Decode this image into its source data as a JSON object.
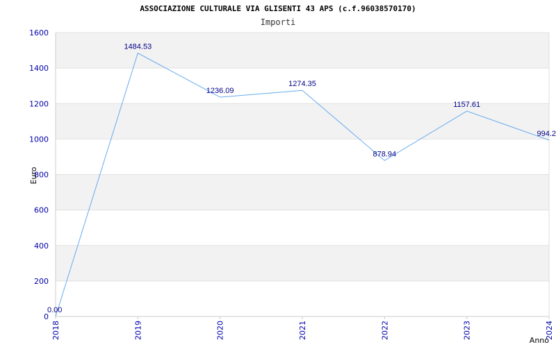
{
  "chart_data": {
    "type": "line",
    "title": "ASSOCIAZIONE CULTURALE VIA GLISENTI 43 APS (c.f.96038570170)",
    "subtitle": "Importi",
    "xlabel": "Anno",
    "ylabel": "Euro",
    "categories": [
      "2018",
      "2019",
      "2020",
      "2021",
      "2022",
      "2023",
      "2024"
    ],
    "series": [
      {
        "values": [
          0.0,
          1484.53,
          1236.09,
          1274.35,
          878.94,
          1157.61,
          994.2
        ],
        "labels": [
          "0.00",
          "1484.53",
          "1236.09",
          "1274.35",
          "878.94",
          "1157.61",
          "994.2"
        ]
      }
    ],
    "ylim": [
      0,
      1600
    ],
    "yticks": [
      "0",
      "200",
      "400",
      "600",
      "800",
      "1000",
      "1200",
      "1400",
      "1600"
    ],
    "grid": "horizontal alternating bands",
    "colors": {
      "line": "#66aaee",
      "band": "#f2f2f2",
      "tick_text": "#0000aa",
      "data_label": "#000088"
    }
  }
}
